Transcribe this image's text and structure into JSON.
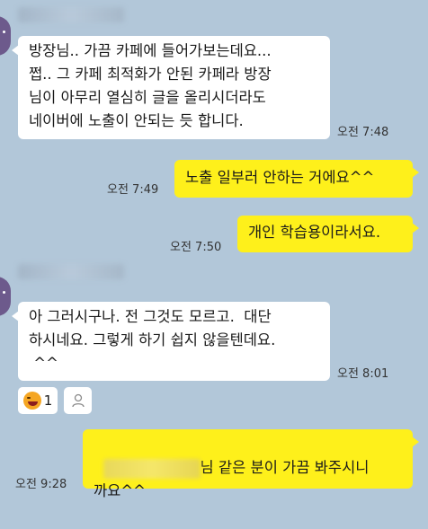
{
  "messages": [
    {
      "side": "left",
      "text": "방장님.. 가끔 카페에 들어가보는데요...\n쩝.. 그 카페 최적화가 안된 카페라 방장\n님이 아무리 열심히 글을 올리시더라도\n네이버에 노출이 안되는 듯 합니다.",
      "time": "오전 7:48"
    },
    {
      "side": "right",
      "text": "노출 일부러 안하는 거에요^^",
      "time": "오전 7:49"
    },
    {
      "side": "right",
      "text": "개인 학습용이라서요.",
      "time": "오전 7:50"
    },
    {
      "side": "left",
      "text": "아 그러시구나. 전 그것도 모르고.  대단\n하시네요. 그렇게 하기 쉽지 않을텐데요.\n ^^",
      "time": "오전 8:01"
    },
    {
      "side": "right",
      "text_line1_suffix": "님 같은 분이 가끔 봐주시니",
      "text_line2": "까요^^",
      "time": "오전 9:28"
    }
  ],
  "reaction": {
    "count": "1",
    "icon": "laughing-emoji-icon"
  },
  "colors": {
    "background": "#b2c7d9",
    "my_bubble": "#fef01b",
    "other_bubble": "#ffffff"
  }
}
